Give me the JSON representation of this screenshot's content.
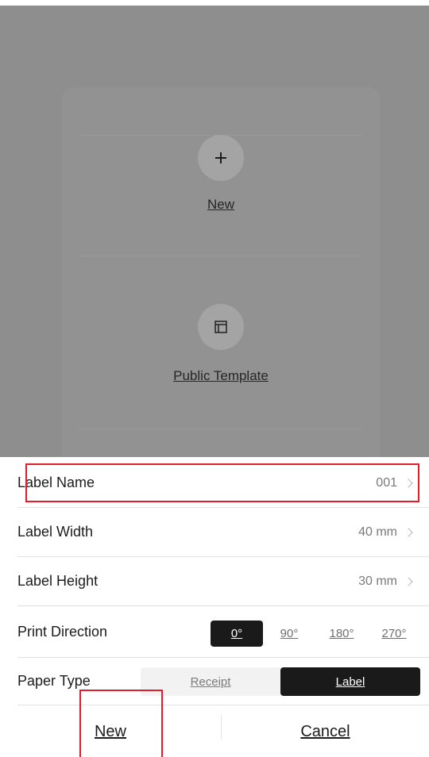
{
  "background": {
    "new_label": "New",
    "new_icon": "plus-icon",
    "template_label": "Public Template",
    "template_icon": "template-icon"
  },
  "sheet": {
    "rows": [
      {
        "label": "Label Name",
        "value": "001"
      },
      {
        "label": "Label Width",
        "value": "40 mm"
      },
      {
        "label": "Label Height",
        "value": "30 mm"
      }
    ],
    "print_direction": {
      "label": "Print Direction",
      "options": [
        "0°",
        "90°",
        "180°",
        "270°"
      ],
      "selected": "0°"
    },
    "paper_type": {
      "label": "Paper Type",
      "options": [
        "Receipt",
        "Label"
      ],
      "selected": "Label"
    },
    "actions": {
      "new_label": "New",
      "cancel_label": "Cancel"
    }
  },
  "colors": {
    "highlight": "#e11c2c",
    "selected": "#1a1a1a",
    "overlay": "#8e8e8e"
  }
}
